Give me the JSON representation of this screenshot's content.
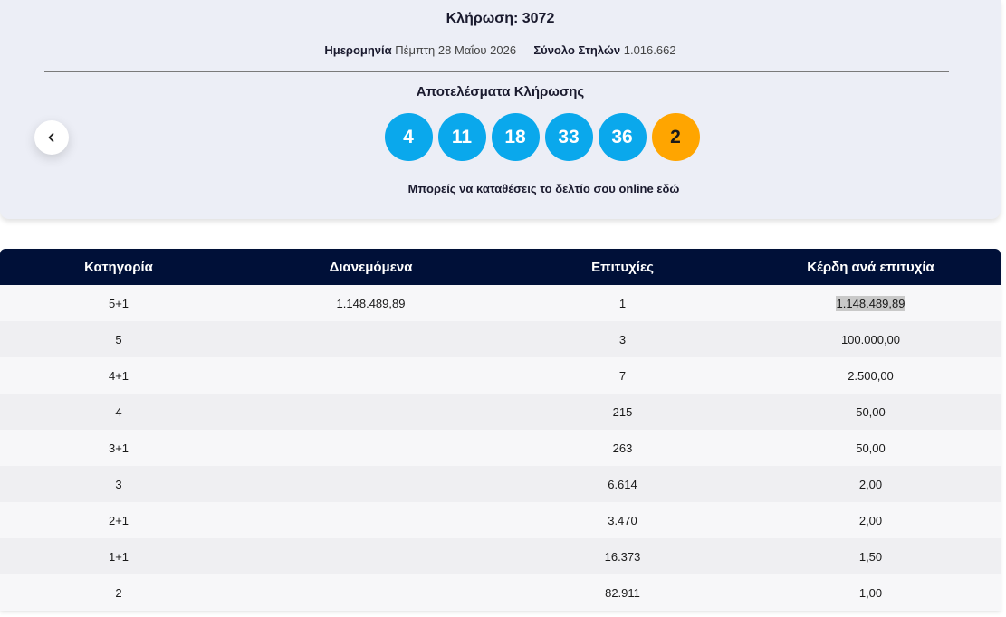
{
  "draw": {
    "title": "Κλήρωση: 3072",
    "date_label": "Ημερομηνία",
    "date_value": "Πέμπτη 28 Μαΐου 2026",
    "columns_label": "Σύνολο Στηλών",
    "columns_value": "1.016.662",
    "results_title": "Αποτελέσματα Κλήρωσης",
    "online_text": "Μπορείς να καταθέσεις το δελτίο σου online εδώ",
    "numbers": [
      "4",
      "11",
      "18",
      "33",
      "36"
    ],
    "joker": "2",
    "colors": {
      "main_ball": "#0aa8ec",
      "joker_ball": "#ffa500",
      "header_bg": "#001038",
      "card_bg": "#eceef6"
    }
  },
  "back_button": {
    "icon": "chevron-left-icon",
    "glyph": "‹"
  },
  "table": {
    "headers": [
      "Κατηγορία",
      "Διανεμόμενα",
      "Επιτυχίες",
      "Κέρδη ανά επιτυχία"
    ],
    "rows": [
      [
        "5+1",
        "1.148.489,89",
        "1",
        "1.148.489,89"
      ],
      [
        "5",
        "",
        "3",
        "100.000,00"
      ],
      [
        "4+1",
        "",
        "7",
        "2.500,00"
      ],
      [
        "4",
        "",
        "215",
        "50,00"
      ],
      [
        "3+1",
        "",
        "263",
        "50,00"
      ],
      [
        "3",
        "",
        "6.614",
        "2,00"
      ],
      [
        "2+1",
        "",
        "3.470",
        "2,00"
      ],
      [
        "1+1",
        "",
        "16.373",
        "1,50"
      ],
      [
        "2",
        "",
        "82.911",
        "1,00"
      ]
    ]
  }
}
